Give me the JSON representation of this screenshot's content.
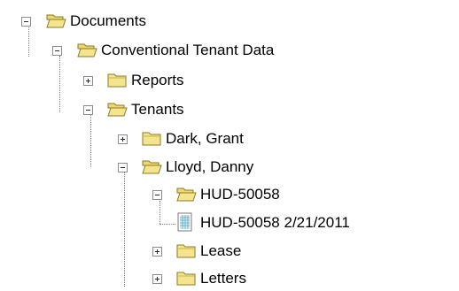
{
  "tree": {
    "nodes": [
      {
        "label": "Documents",
        "level": 0,
        "expanded": true,
        "icon": "folder-open-icon"
      },
      {
        "label": "Conventional Tenant Data",
        "level": 1,
        "expanded": true,
        "icon": "folder-open-icon"
      },
      {
        "label": "Reports",
        "level": 2,
        "expanded": false,
        "icon": "folder-closed-icon"
      },
      {
        "label": "Tenants",
        "level": 2,
        "expanded": true,
        "icon": "folder-open-icon"
      },
      {
        "label": "Dark, Grant",
        "level": 3,
        "expanded": false,
        "icon": "folder-closed-icon"
      },
      {
        "label": "Lloyd, Danny",
        "level": 3,
        "expanded": true,
        "icon": "folder-open-icon"
      },
      {
        "label": "HUD-50058",
        "level": 4,
        "expanded": true,
        "icon": "folder-open-icon"
      },
      {
        "label": "HUD-50058 2/21/2011",
        "level": 5,
        "expanded": null,
        "icon": "form-document-icon"
      },
      {
        "label": "Lease",
        "level": 4,
        "expanded": false,
        "icon": "folder-closed-icon"
      },
      {
        "label": "Letters",
        "level": 4,
        "expanded": false,
        "icon": "folder-closed-icon"
      }
    ]
  },
  "colors": {
    "folder_fill": "#f4e58c",
    "folder_edge": "#8a7a2a",
    "connector": "#7f7f7f"
  }
}
